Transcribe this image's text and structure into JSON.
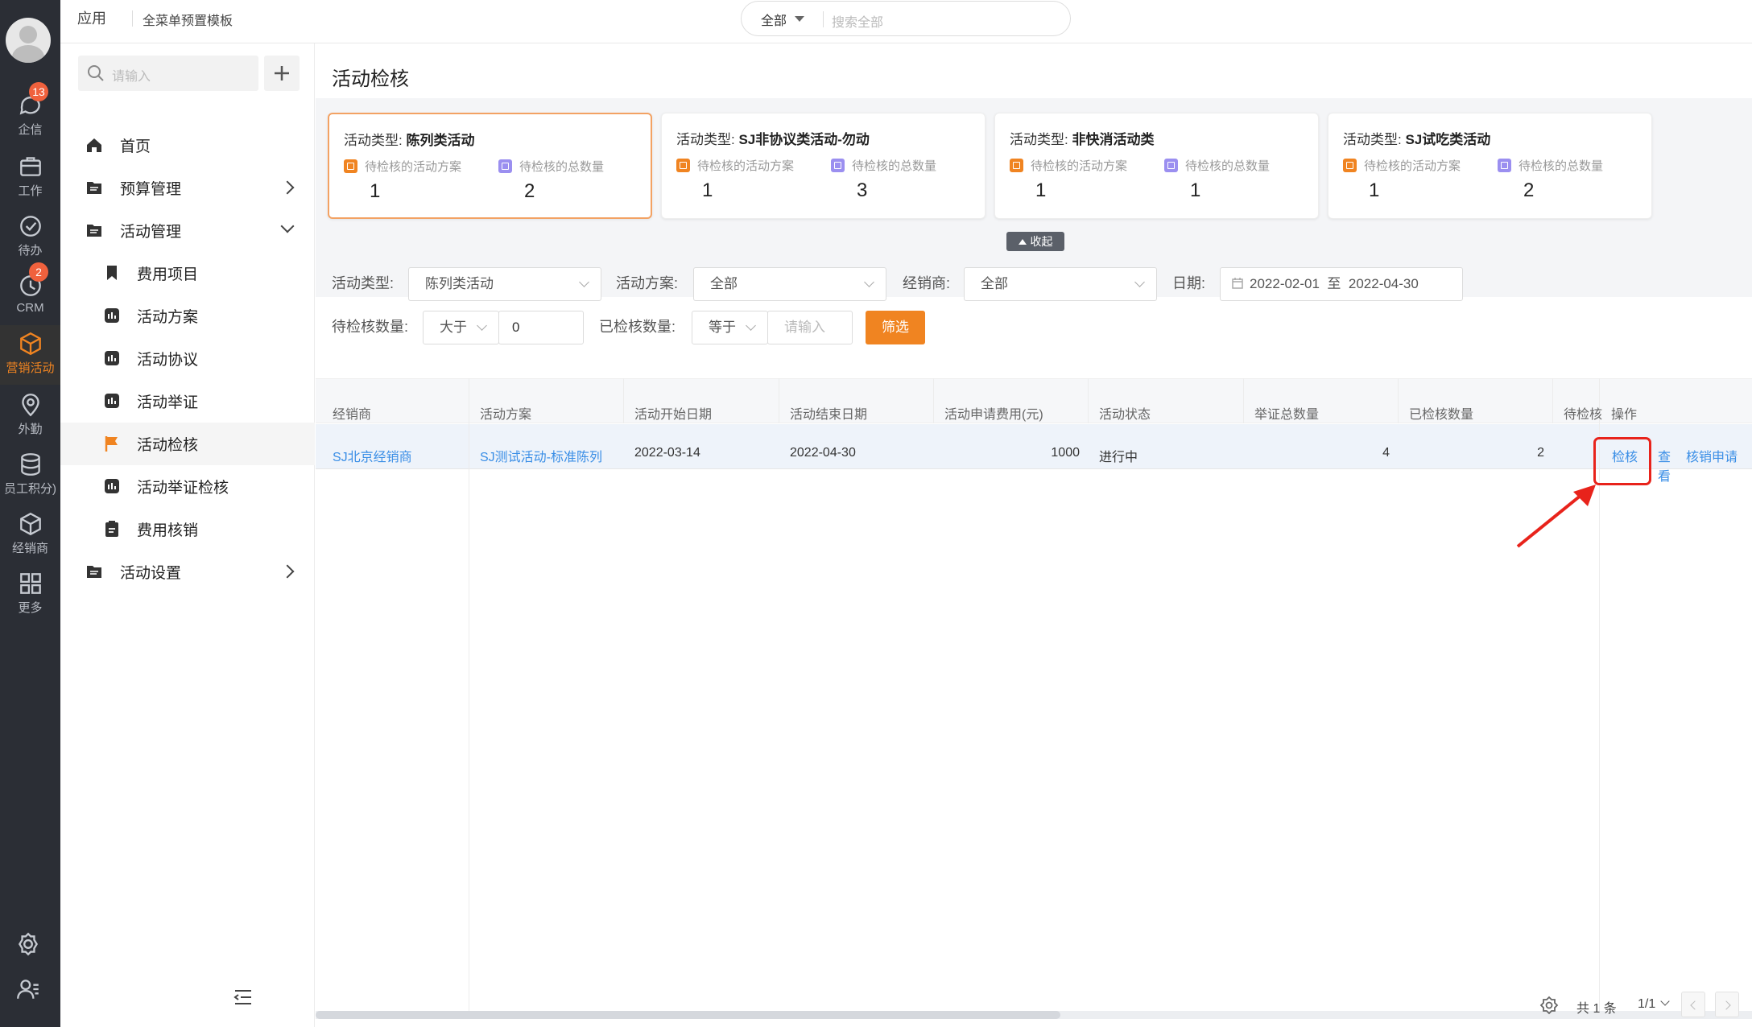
{
  "nav": {
    "items": [
      {
        "label": "企信",
        "icon": "chat-icon",
        "badge": "13"
      },
      {
        "label": "工作",
        "icon": "briefcase-icon"
      },
      {
        "label": "待办",
        "icon": "check-circle-icon"
      },
      {
        "label": "CRM",
        "icon": "clock-icon",
        "badge": "2"
      },
      {
        "label": "营销活动",
        "icon": "cube-icon"
      },
      {
        "label": "外勤",
        "icon": "location-icon"
      },
      {
        "label": "员工积分)",
        "icon": "database-icon"
      },
      {
        "label": "经销商",
        "icon": "box-icon"
      },
      {
        "label": "更多",
        "icon": "grid-icon"
      }
    ],
    "active": "营销活动"
  },
  "topbar": {
    "app": "应用",
    "template": "全菜单预置模板",
    "scope": "全部",
    "search_placeholder": "搜索全部"
  },
  "menu": {
    "search_placeholder": "请输入",
    "items": [
      {
        "label": "首页"
      },
      {
        "label": "预算管理"
      },
      {
        "label": "活动管理"
      },
      {
        "label": "费用项目"
      },
      {
        "label": "活动方案"
      },
      {
        "label": "活动协议"
      },
      {
        "label": "活动举证"
      },
      {
        "label": "活动检核"
      },
      {
        "label": "活动举证检核"
      },
      {
        "label": "费用核销"
      },
      {
        "label": "活动设置"
      }
    ],
    "active": "活动检核"
  },
  "page": {
    "title": "活动检核",
    "collapse": "收起"
  },
  "cards": [
    {
      "prefix": "活动类型:",
      "type": "陈列类活动",
      "l1": "待检核的活动方案",
      "v1": "1",
      "l2": "待检核的总数量",
      "v2": "2"
    },
    {
      "prefix": "活动类型:",
      "type": "SJ非协议类活动-勿动",
      "l1": "待检核的活动方案",
      "v1": "1",
      "l2": "待检核的总数量",
      "v2": "3"
    },
    {
      "prefix": "活动类型:",
      "type": "非快消活动类",
      "l1": "待检核的活动方案",
      "v1": "1",
      "l2": "待检核的总数量",
      "v2": "1"
    },
    {
      "prefix": "活动类型:",
      "type": "SJ试吃类活动",
      "l1": "待检核的活动方案",
      "v1": "1",
      "l2": "待检核的总数量",
      "v2": "2"
    }
  ],
  "filters": {
    "type_label": "活动类型:",
    "type_value": "陈列类活动",
    "plan_label": "活动方案:",
    "plan_value": "全部",
    "dealer_label": "经销商:",
    "dealer_value": "全部",
    "date_label": "日期:",
    "date_from": "2022-02-01",
    "date_sep": "至",
    "date_to": "2022-04-30",
    "pending_label": "待检核数量:",
    "pending_op": "大于",
    "pending_value": "0",
    "checked_label": "已检核数量:",
    "checked_op": "等于",
    "checked_placeholder": "请输入",
    "filter_button": "筛选"
  },
  "table": {
    "headers": [
      "经销商",
      "活动方案",
      "活动开始日期",
      "活动结束日期",
      "活动申请费用(元)",
      "活动状态",
      "举证总数量",
      "已检核数量",
      "待检核",
      "操作"
    ],
    "rows": [
      {
        "dealer": "SJ北京经销商",
        "plan": "SJ测试活动-标准陈列",
        "start": "2022-03-14",
        "end": "2022-04-30",
        "fee": "1000",
        "status": "进行中",
        "proof_total": "4",
        "checked": "2",
        "actions": [
          "检核",
          "查看",
          "核销申请"
        ]
      }
    ]
  },
  "pager": {
    "total": "共 1 条",
    "page": "1/1"
  },
  "colors": {
    "accent": "#f08421",
    "link": "#3a8ee6",
    "highlight": "#e8231b",
    "nav_bg": "#2b2e35"
  }
}
